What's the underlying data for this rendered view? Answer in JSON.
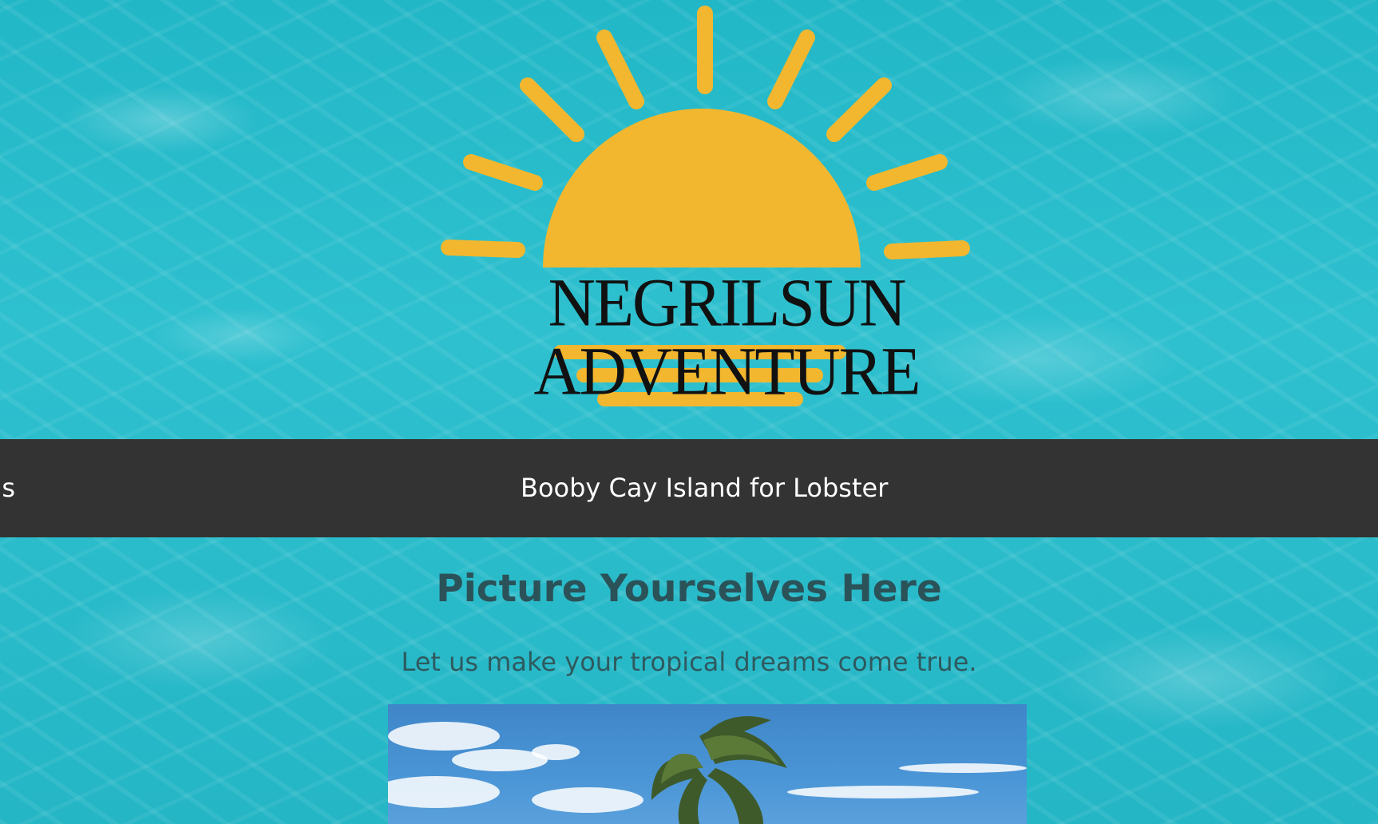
{
  "logo": {
    "text": "NEGRILSUN ADVENTURE",
    "sun_color": "#F2B72F"
  },
  "nav": {
    "partial_item": "s",
    "active_item": "Booby Cay Island for Lobster",
    "background": "#333333"
  },
  "hero": {
    "title": "Picture Yourselves Here",
    "subtitle": "Let us make your tropical dreams come true."
  },
  "photo": {
    "subject": "palm-tree-sky"
  }
}
